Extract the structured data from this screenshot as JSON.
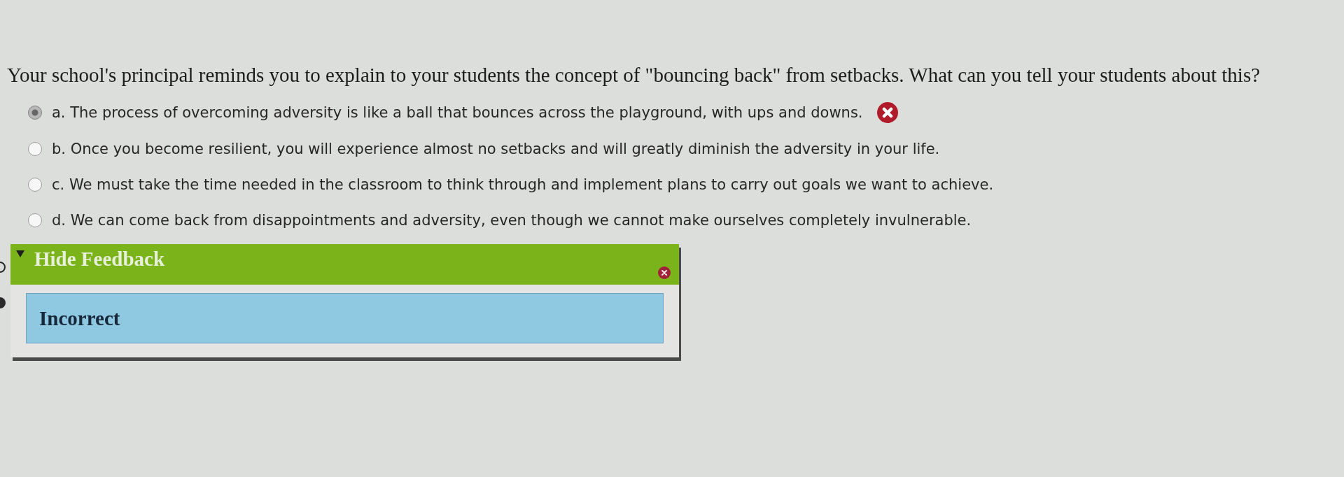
{
  "question": {
    "text": "Your school's principal reminds you to explain to your students the concept of \"bouncing back\" from setbacks. What can you tell your students about this?"
  },
  "options": [
    {
      "text": "a. The process of overcoming adversity is like a ball that bounces across the playground, with ups and downs.",
      "selected": true,
      "marked_incorrect": true
    },
    {
      "text": "b. Once you become resilient, you will experience almost no setbacks and will greatly diminish the adversity in your life.",
      "selected": false,
      "marked_incorrect": false
    },
    {
      "text": "c. We must take the time needed in the classroom to think through and implement plans to carry out goals we want to achieve.",
      "selected": false,
      "marked_incorrect": false
    },
    {
      "text": "d. We can come back from disappointments and adversity, even though we cannot make ourselves completely invulnerable.",
      "selected": false,
      "marked_incorrect": false
    }
  ],
  "feedback": {
    "toggle_label": "Hide Feedback",
    "expanded": true,
    "message": "Incorrect"
  }
}
